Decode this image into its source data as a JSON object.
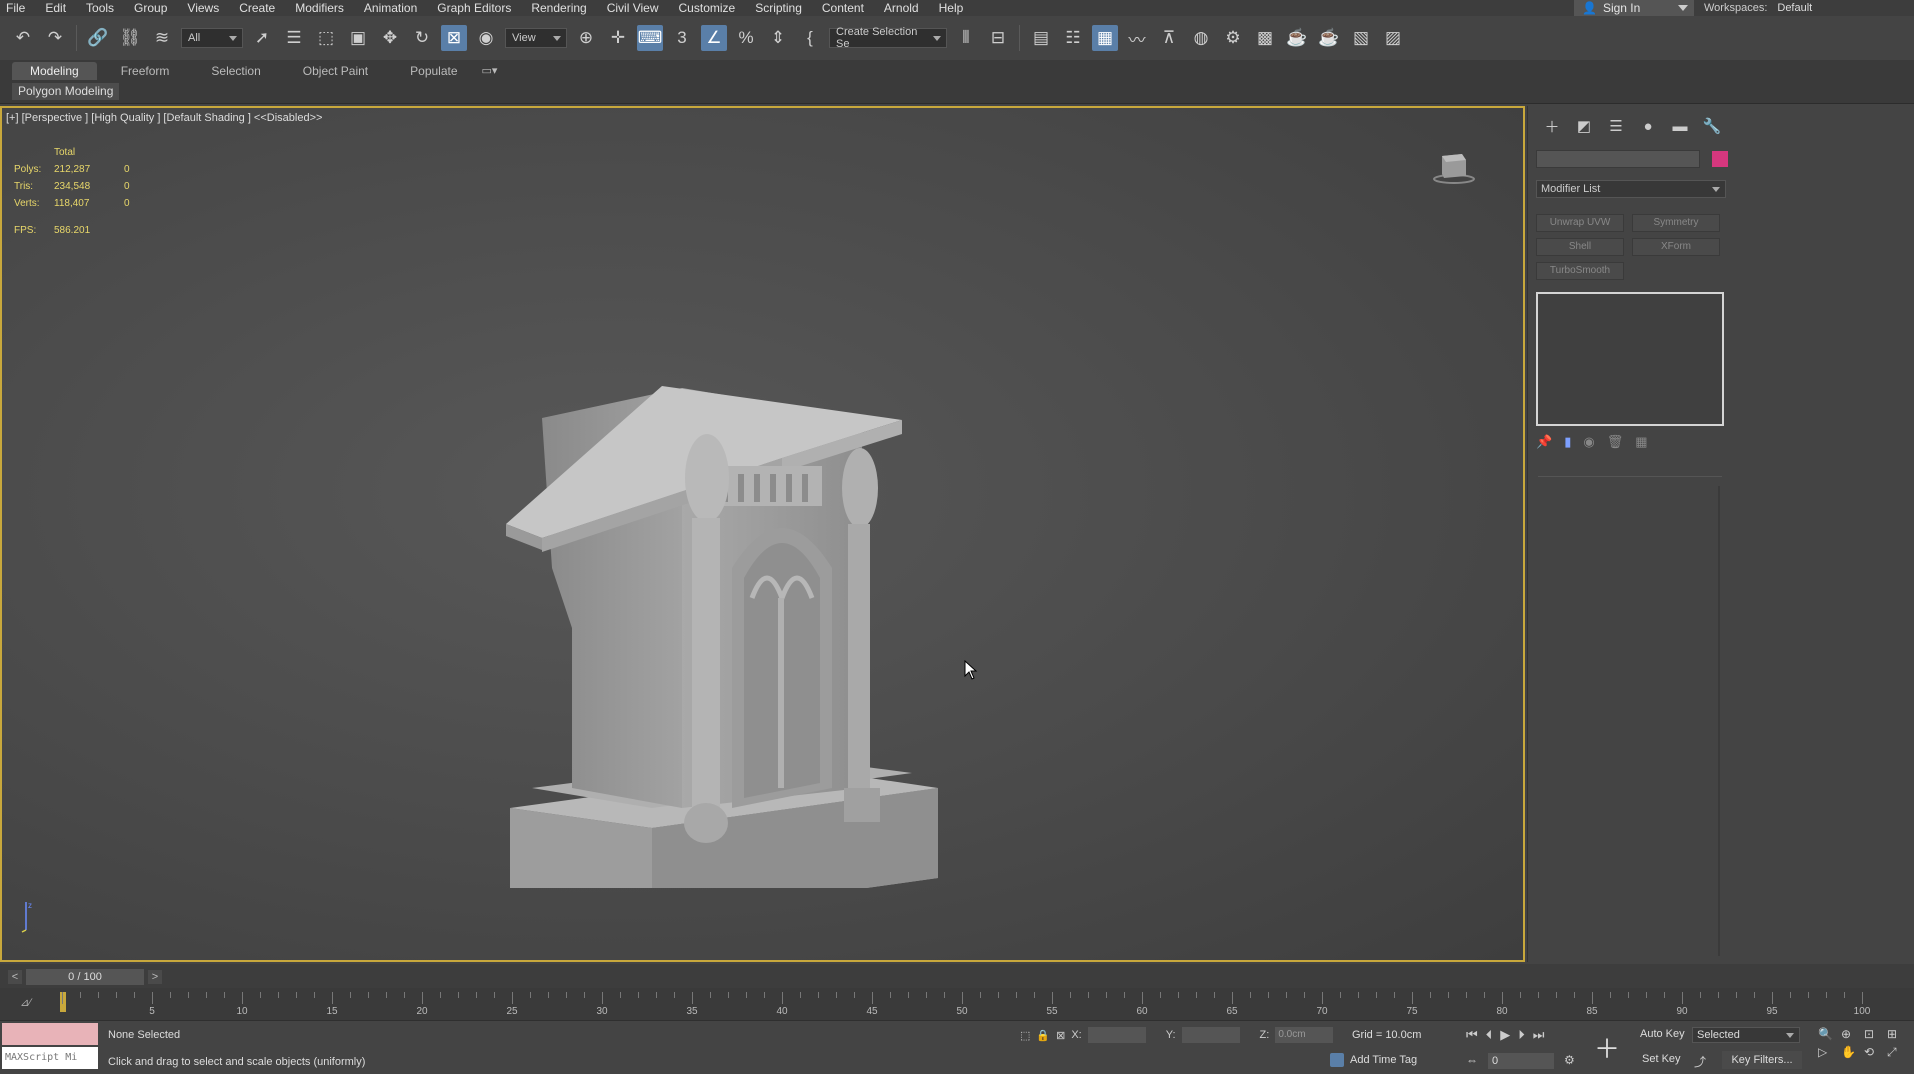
{
  "menubar": {
    "items": [
      "File",
      "Edit",
      "Tools",
      "Group",
      "Views",
      "Create",
      "Modifiers",
      "Animation",
      "Graph Editors",
      "Rendering",
      "Civil View",
      "Customize",
      "Scripting",
      "Content",
      "Arnold",
      "Help"
    ],
    "sign_in": "Sign In",
    "workspaces_label": "Workspaces:",
    "workspaces_value": "Default"
  },
  "toolbar": {
    "selection_filter": "All",
    "ref_coord": "View",
    "named_selection": "Create Selection Se"
  },
  "ribbon": {
    "tabs": [
      "Modeling",
      "Freeform",
      "Selection",
      "Object Paint",
      "Populate"
    ],
    "active_tab": "Modeling",
    "sub_label": "Polygon Modeling"
  },
  "viewport": {
    "label": "[+] [Perspective ] [High Quality ] [Default Shading ]  <<Disabled>>",
    "stats": {
      "header": "Total",
      "polys_label": "Polys:",
      "polys_total": "212,287",
      "polys_sel": "0",
      "tris_label": "Tris:",
      "tris_total": "234,548",
      "tris_sel": "0",
      "verts_label": "Verts:",
      "verts_total": "118,407",
      "verts_sel": "0",
      "fps_label": "FPS:",
      "fps_value": "586.201"
    }
  },
  "command_panel": {
    "modifier_list": "Modifier List",
    "buttons": [
      "Unwrap UVW",
      "Symmetry",
      "Shell",
      "XForm",
      "TurboSmooth"
    ],
    "object_color": "#d6377e"
  },
  "time_slider": {
    "value": "0 / 100",
    "prev": "<",
    "next": ">"
  },
  "trackbar": {
    "filter_icon": "filter-icon",
    "ticks": [
      "5",
      "10",
      "15",
      "20",
      "25",
      "30",
      "35",
      "40",
      "45",
      "50",
      "55",
      "60",
      "65",
      "70",
      "75",
      "80",
      "85",
      "90",
      "95",
      "100"
    ]
  },
  "statusbar": {
    "maxscript": "MAXScript Mi",
    "selection_status": "None Selected",
    "prompt": "Click and drag to select and scale objects (uniformly)",
    "x_label": "X:",
    "x_value": "",
    "y_label": "Y:",
    "y_value": "",
    "z_label": "Z:",
    "z_value": "0.0cm",
    "grid": "Grid = 10.0cm",
    "add_time_tag": "Add Time Tag",
    "frame": "0",
    "auto_key": "Auto Key",
    "set_key": "Set Key",
    "key_mode": "Selected",
    "key_filters": "Key Filters..."
  },
  "colors": {
    "viewport_border": "#c8a83c",
    "stats_text": "#e8d76a",
    "active_tool": "#5a7fa8"
  }
}
